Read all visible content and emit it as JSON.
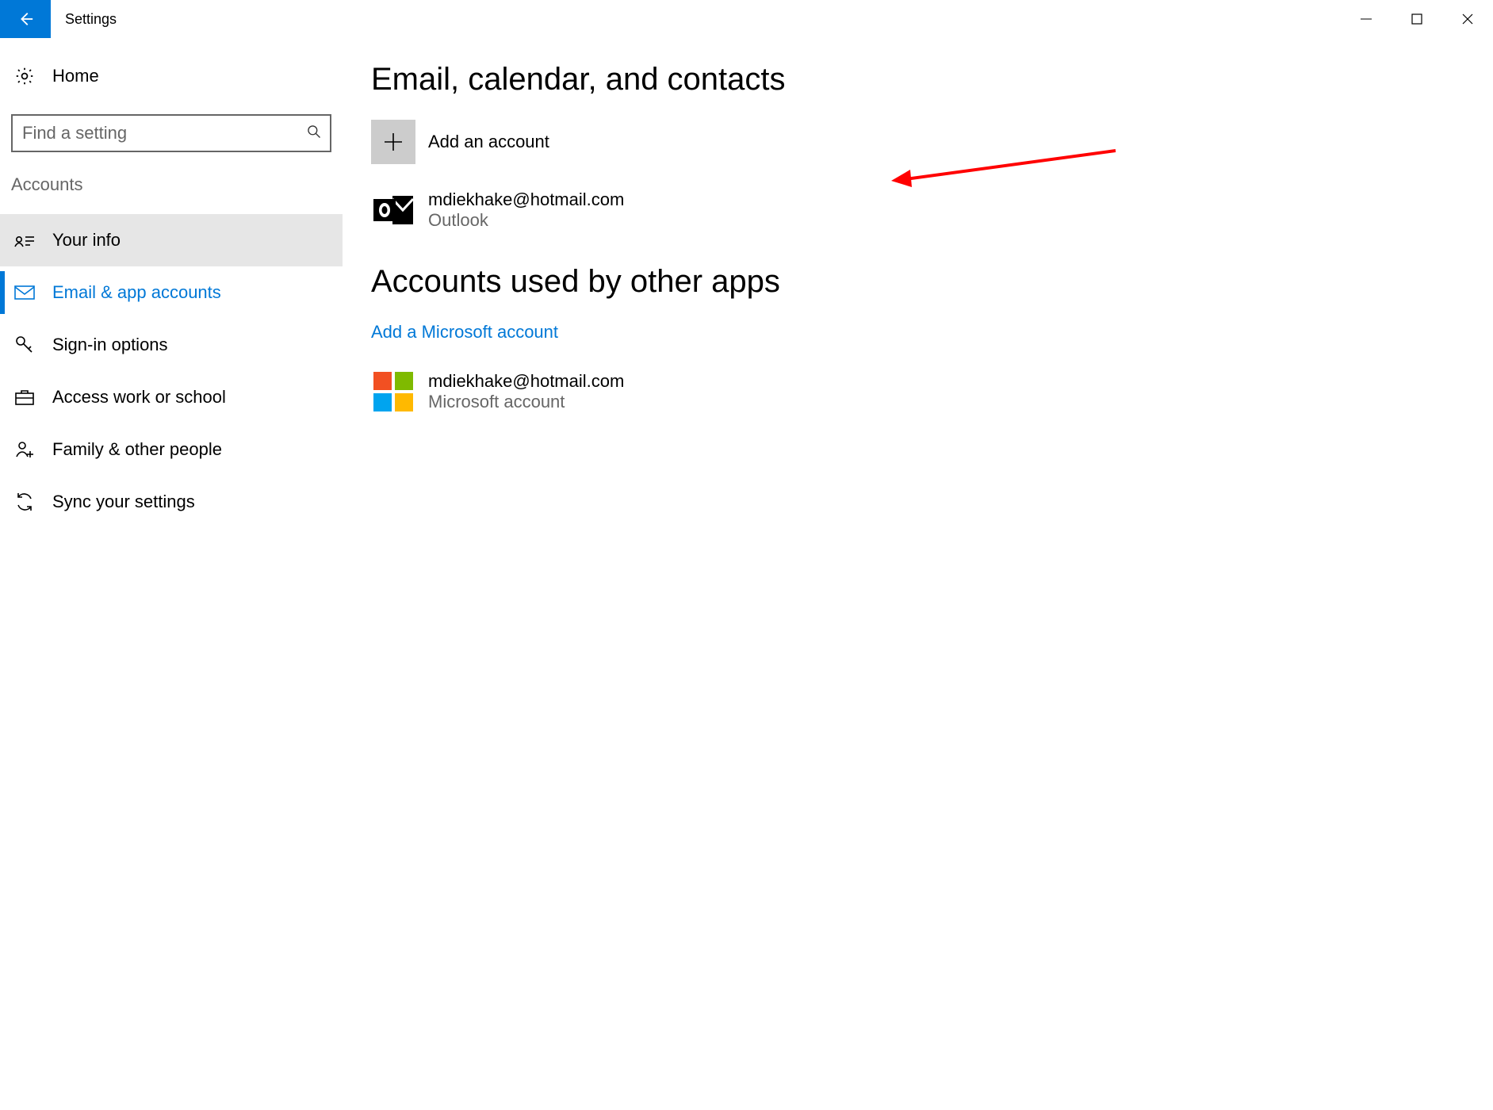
{
  "window": {
    "title": "Settings"
  },
  "sidebar": {
    "home_label": "Home",
    "search_placeholder": "Find a setting",
    "category": "Accounts",
    "items": [
      {
        "label": "Your info"
      },
      {
        "label": "Email & app accounts"
      },
      {
        "label": "Sign-in options"
      },
      {
        "label": "Access work or school"
      },
      {
        "label": "Family & other people"
      },
      {
        "label": "Sync your settings"
      }
    ]
  },
  "content": {
    "section1_title": "Email, calendar, and contacts",
    "add_account_label": "Add an account",
    "email_account": {
      "email": "mdiekhake@hotmail.com",
      "provider": "Outlook"
    },
    "section2_title": "Accounts used by other apps",
    "add_ms_link": "Add a Microsoft account",
    "ms_account": {
      "email": "mdiekhake@hotmail.com",
      "type": "Microsoft account"
    }
  },
  "colors": {
    "accent": "#0078d7",
    "ms_logo": {
      "tl": "#f25022",
      "tr": "#7fba00",
      "bl": "#00a4ef",
      "br": "#ffb900"
    },
    "annotation": "#ff0000"
  }
}
